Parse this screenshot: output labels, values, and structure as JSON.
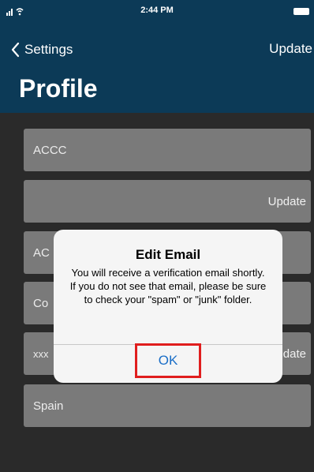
{
  "status": {
    "time": "2:44 PM"
  },
  "nav": {
    "back_label": "Settings",
    "action_label": "Update"
  },
  "page": {
    "title": "Profile"
  },
  "fields": [
    {
      "value": "ACCC",
      "right": ""
    },
    {
      "value": "",
      "right": "Update"
    },
    {
      "value": "AC",
      "right": ""
    },
    {
      "value": "Co",
      "right": ""
    },
    {
      "value": "xxx",
      "right": "date"
    },
    {
      "value": "Spain",
      "right": ""
    }
  ],
  "dialog": {
    "title": "Edit Email",
    "message": "You will receive a verification email shortly. If you do not see that email, please be sure to check your \"spam\" or \"junk\" folder.",
    "ok_label": "OK"
  },
  "colors": {
    "header": "#0c3a57",
    "ok_highlight": "#e01e1e",
    "ok_text": "#1a6ec7"
  },
  "icons": {
    "back": "chevron-left-icon",
    "signal": "signal-wifi-icon",
    "battery": "battery-icon"
  }
}
